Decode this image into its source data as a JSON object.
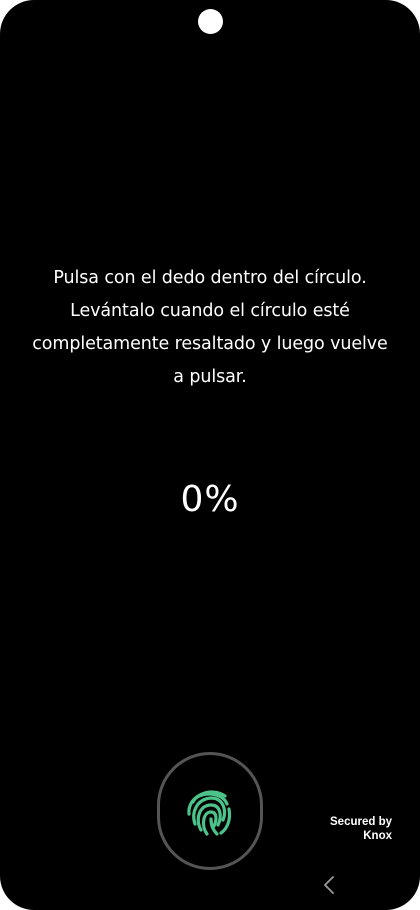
{
  "instruction": {
    "line1": "Pulsa con el dedo dentro del círculo.",
    "line2": "Levántalo cuando el círculo esté",
    "line3": "completamente resaltado y luego vuelve",
    "line4": "a pulsar."
  },
  "progress": {
    "label": "0%",
    "value": 0
  },
  "sensor": {
    "icon": "fingerprint-icon",
    "accent_color": "#4cc38a"
  },
  "footer": {
    "knox_line1": "Secured by",
    "knox_line2": "Knox"
  },
  "nav": {
    "back_icon": "chevron-left-icon"
  }
}
